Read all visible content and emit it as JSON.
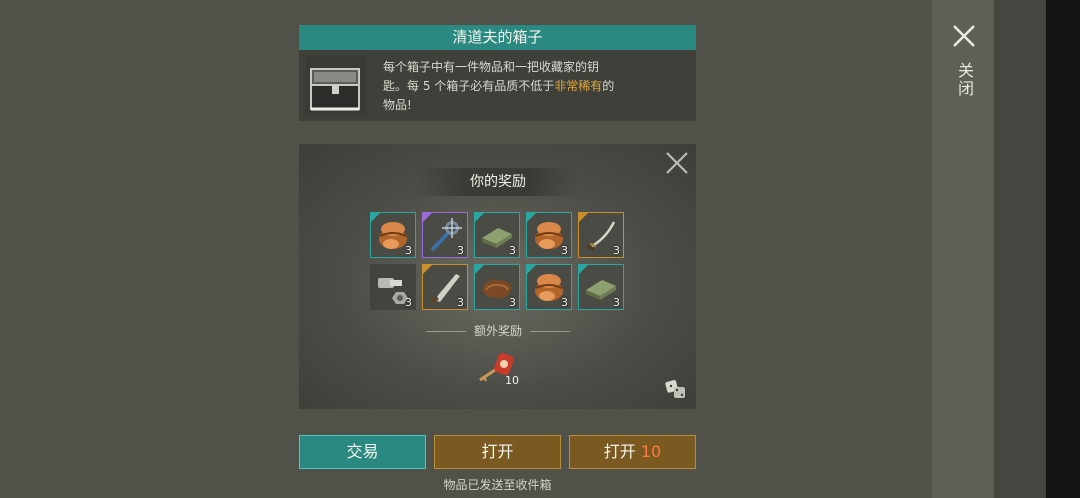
{
  "box": {
    "title": "清道夫的箱子",
    "desc_line1": "每个箱子中有一件物品和一把收藏家的钥",
    "desc_line2_pre": "匙。每 5 个箱子必有品质不低于",
    "desc_line2_hl": "非常稀有",
    "desc_line2_post": "的",
    "desc_line3": "物品!"
  },
  "side": {
    "close_label": "关闭",
    "close_icon": "close-icon"
  },
  "rewards": {
    "title": "你的奖励",
    "items": [
      {
        "name": "leather-pouch-icon",
        "qty": "3",
        "rarity": "teal"
      },
      {
        "name": "spiked-mace-icon",
        "qty": "3",
        "rarity": "purple"
      },
      {
        "name": "cloth-bundle-icon",
        "qty": "3",
        "rarity": "teal"
      },
      {
        "name": "leather-pouch-icon",
        "qty": "3",
        "rarity": "teal"
      },
      {
        "name": "saber-icon",
        "qty": "3",
        "rarity": "gold"
      },
      {
        "name": "bolt-nut-icon",
        "qty": "3",
        "rarity": "none"
      },
      {
        "name": "machete-icon",
        "qty": "3",
        "rarity": "gold"
      },
      {
        "name": "leather-hide-icon",
        "qty": "3",
        "rarity": "teal"
      },
      {
        "name": "leather-pouch-icon",
        "qty": "3",
        "rarity": "teal"
      },
      {
        "name": "cloth-bundle-icon",
        "qty": "3",
        "rarity": "teal"
      }
    ],
    "bonus_title": "额外奖励",
    "bonus_item": {
      "name": "collector-key-icon",
      "qty": "10"
    }
  },
  "buttons": {
    "trade": "交易",
    "open": "打开",
    "open10_label": "打开",
    "open10_num": "10"
  },
  "footer": "物品已发送至收件箱",
  "colors": {
    "teal": "#2a8a82",
    "gold_button": "#7a5a20",
    "highlight": "#e0a83a",
    "open10_num": "#ff7b42"
  }
}
